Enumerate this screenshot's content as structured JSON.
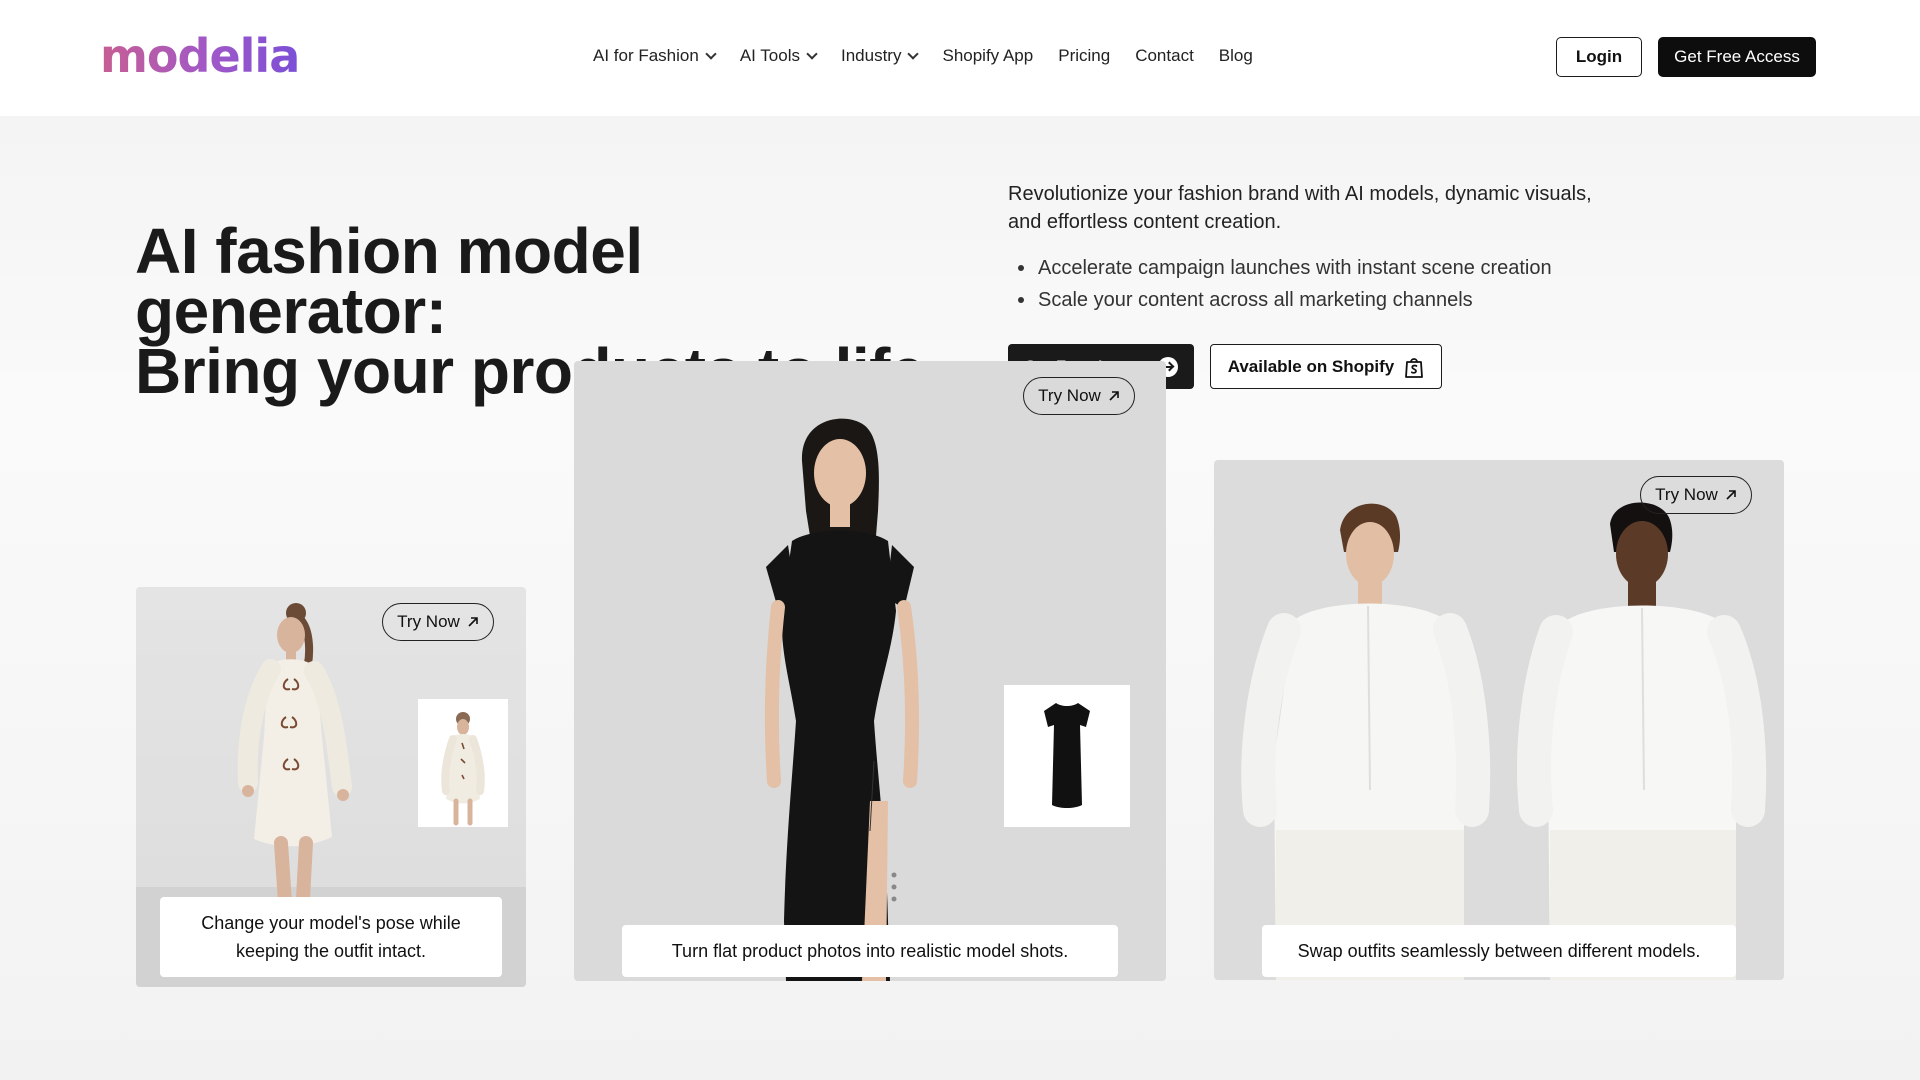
{
  "brand": {
    "logo_text": "modelia"
  },
  "nav": {
    "items": [
      {
        "label": "AI for Fashion",
        "dropdown": true
      },
      {
        "label": "AI Tools",
        "dropdown": true
      },
      {
        "label": "Industry",
        "dropdown": true
      },
      {
        "label": "Shopify App",
        "dropdown": false
      },
      {
        "label": "Pricing",
        "dropdown": false
      },
      {
        "label": "Contact",
        "dropdown": false
      },
      {
        "label": "Blog",
        "dropdown": false
      }
    ],
    "login_label": "Login",
    "cta_label": "Get Free Access"
  },
  "hero": {
    "headline_line1": "AI fashion model generator:",
    "headline_line2": "Bring your products to life",
    "intro_line1": "Revolutionize your fashion brand with AI models, dynamic visuals,",
    "intro_line2": "and effortless content creation.",
    "bullets": [
      "Accelerate campaign launches with instant scene creation",
      "Scale your content across all marketing channels"
    ],
    "primary_cta": "Get Free Access",
    "secondary_cta": "Available on Shopify"
  },
  "cards": [
    {
      "try_label": "Try Now",
      "caption_line1": "Change your model's pose while",
      "caption_line2": "keeping the outfit intact."
    },
    {
      "try_label": "Try Now",
      "caption": "Turn flat product photos into realistic model shots."
    },
    {
      "try_label": "Try Now",
      "caption": "Swap outfits seamlessly between different models."
    }
  ],
  "colors": {
    "brand_gradient_start": "#c85e93",
    "brand_gradient_end": "#7b4fd6",
    "button_dark": "#0d0d0d",
    "hero_bg": "#f7f7f7"
  },
  "icons": {
    "nav_dropdown": "chevron-down-icon",
    "hero_cta": "arrow-right-circle-icon",
    "shopify": "shopify-bag-icon",
    "try_now": "arrow-up-right-icon"
  }
}
